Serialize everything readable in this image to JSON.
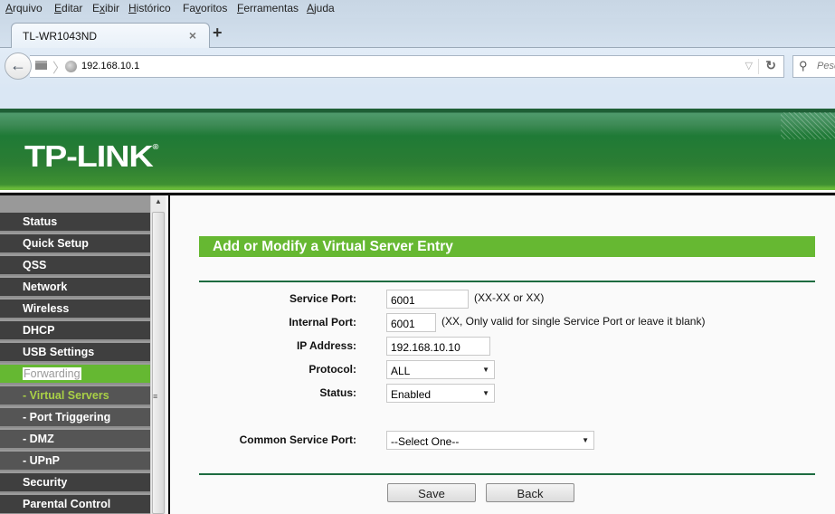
{
  "browser": {
    "menu": [
      {
        "label": "Arquivo",
        "key": "A",
        "rest": "rquivo"
      },
      {
        "label": "Editar",
        "key": "E",
        "rest": "ditar"
      },
      {
        "label": "Exibir",
        "pre": "E",
        "key": "x",
        "rest": "ibir"
      },
      {
        "label": "Histórico",
        "key": "H",
        "rest": "istórico"
      },
      {
        "label": "Favoritos",
        "pre": "Fa",
        "key": "v",
        "rest": "oritos"
      },
      {
        "label": "Ferramentas",
        "key": "F",
        "rest": "erramentas"
      },
      {
        "label": "Ajuda",
        "key": "A",
        "rest": "juda"
      }
    ],
    "tab_title": "TL-WR1043ND",
    "tab_close": "×",
    "new_tab": "+",
    "url": "192.168.10.1",
    "search_placeholder": "Pesquisar",
    "icons": {
      "back": "←",
      "dropmarker": "▽",
      "reload": "↻",
      "search": "🔍"
    }
  },
  "router": {
    "logo": "TP-LINK",
    "logo_mark": "®",
    "accent_green": "#66b832",
    "sidebar": {
      "items": [
        {
          "label": "Status",
          "type": "main"
        },
        {
          "label": "Quick Setup",
          "type": "main"
        },
        {
          "label": "QSS",
          "type": "main"
        },
        {
          "label": "Network",
          "type": "main"
        },
        {
          "label": "Wireless",
          "type": "main"
        },
        {
          "label": "DHCP",
          "type": "main"
        },
        {
          "label": "USB Settings",
          "type": "main"
        },
        {
          "label": "Forwarding",
          "type": "active"
        },
        {
          "label": "- Virtual Servers",
          "type": "sub-active"
        },
        {
          "label": "- Port Triggering",
          "type": "sub"
        },
        {
          "label": "- DMZ",
          "type": "sub"
        },
        {
          "label": "- UPnP",
          "type": "sub"
        },
        {
          "label": "Security",
          "type": "main"
        },
        {
          "label": "Parental Control",
          "type": "main"
        }
      ]
    },
    "form": {
      "title": "Add or Modify a Virtual Server Entry",
      "service_port": {
        "label": "Service Port:",
        "value": "6001",
        "hint": "(XX-XX or XX)"
      },
      "internal_port": {
        "label": "Internal Port:",
        "value": "6001",
        "hint": "(XX, Only valid for single Service Port or leave it blank)"
      },
      "ip_address": {
        "label": "IP Address:",
        "value": "192.168.10.10"
      },
      "protocol": {
        "label": "Protocol:",
        "selected": "ALL"
      },
      "status": {
        "label": "Status:",
        "selected": "Enabled"
      },
      "common_service_port": {
        "label": "Common Service Port:",
        "selected": "--Select One--"
      },
      "save_label": "Save",
      "back_label": "Back"
    }
  }
}
